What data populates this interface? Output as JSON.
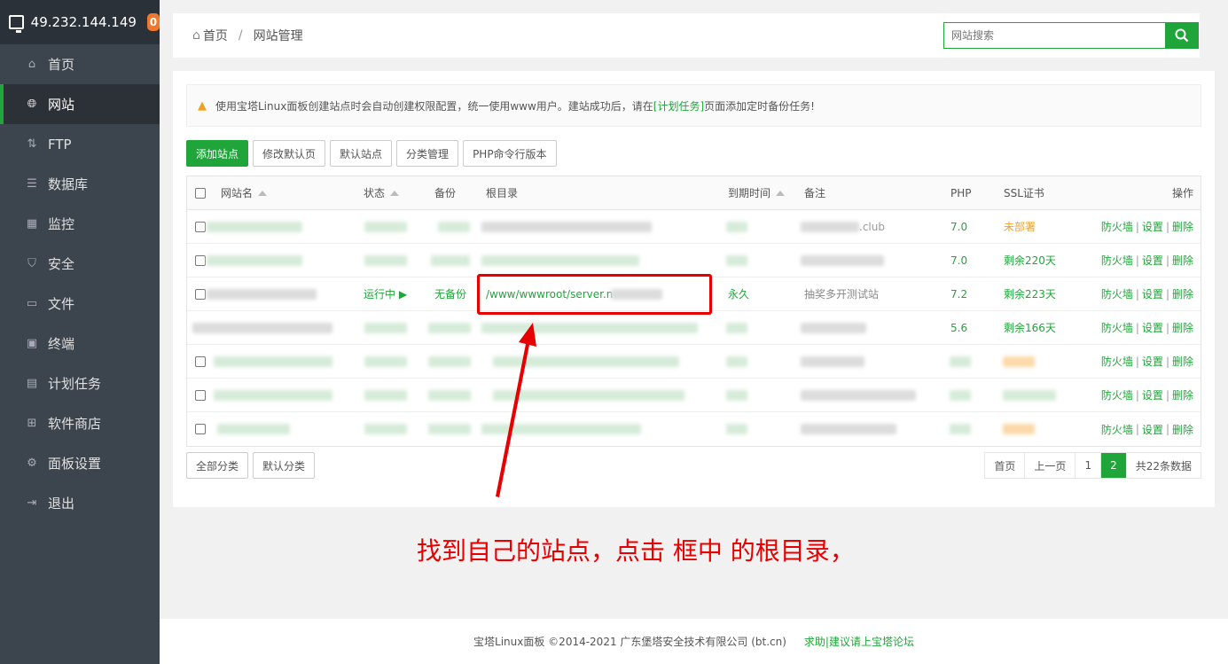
{
  "sidebar": {
    "ip": "49.232.144.149",
    "badge": "0",
    "items": [
      {
        "label": "首页",
        "icon": "home-icon"
      },
      {
        "label": "网站",
        "icon": "globe-icon"
      },
      {
        "label": "FTP",
        "icon": "ftp-icon"
      },
      {
        "label": "数据库",
        "icon": "database-icon"
      },
      {
        "label": "监控",
        "icon": "monitor-chart-icon"
      },
      {
        "label": "安全",
        "icon": "shield-icon"
      },
      {
        "label": "文件",
        "icon": "folder-icon"
      },
      {
        "label": "终端",
        "icon": "terminal-icon"
      },
      {
        "label": "计划任务",
        "icon": "calendar-icon"
      },
      {
        "label": "软件商店",
        "icon": "grid-icon"
      },
      {
        "label": "面板设置",
        "icon": "gear-icon"
      },
      {
        "label": "退出",
        "icon": "logout-icon"
      }
    ]
  },
  "header": {
    "breadcrumb_home": "首页",
    "breadcrumb_sep": "/",
    "breadcrumb_current": "网站管理",
    "search_placeholder": "网站搜索"
  },
  "notice": {
    "text_before": "使用宝塔Linux面板创建站点时会自动创建权限配置，统一使用www用户。建站成功后，请在",
    "link": "[计划任务]",
    "text_after": "页面添加定时备份任务!"
  },
  "toolbar": {
    "add_site": "添加站点",
    "edit_default_page": "修改默认页",
    "default_site": "默认站点",
    "category_manage": "分类管理",
    "php_cli": "PHP命令行版本"
  },
  "table": {
    "headers": {
      "name": "网站名",
      "status": "状态",
      "backup": "备份",
      "root": "根目录",
      "expire": "到期时间",
      "remark": "备注",
      "php": "PHP",
      "ssl": "SSL证书",
      "ops": "操作"
    },
    "rows": [
      {
        "remark": ".club",
        "php": "7.0",
        "ssl": "未部署",
        "ssl_state": "orange"
      },
      {
        "remark": "",
        "php": "7.0",
        "ssl": "剩余220天",
        "ssl_state": "green"
      },
      {
        "status": "运行中 ▶",
        "backup": "无备份",
        "root": "/www/wwwroot/server.n",
        "expire": "永久",
        "remark": "抽奖多开测试站",
        "php": "7.2",
        "ssl": "剩余223天",
        "ssl_state": "green"
      },
      {
        "remark": "",
        "php": "5.6",
        "ssl": "剩余166天",
        "ssl_state": "green"
      },
      {
        "remark": "",
        "php": "",
        "ssl": "",
        "ssl_state": "blur"
      },
      {
        "remark": "",
        "php": "",
        "ssl": "",
        "ssl_state": "blur"
      },
      {
        "remark": "",
        "php": "",
        "ssl": "",
        "ssl_state": "blur"
      }
    ],
    "ops": {
      "firewall": "防火墙",
      "settings": "设置",
      "delete": "删除",
      "sep": "|"
    }
  },
  "bottom": {
    "all_categories": "全部分类",
    "default_category": "默认分类"
  },
  "pager": {
    "first": "首页",
    "prev": "上一页",
    "page1": "1",
    "page2": "2",
    "total": "共22条数据"
  },
  "annotation": {
    "caption": "找到自己的站点，点击 框中 的根目录，"
  },
  "footer": {
    "copyright": "宝塔Linux面板 ©2014-2021 广东堡塔安全技术有限公司 (bt.cn)",
    "help": "求助|建议请上宝塔论坛"
  },
  "colors": {
    "accent": "#20a53a",
    "sidebar_bg": "#3c444d",
    "highlight": "#e60000",
    "warning": "#f0a020"
  }
}
